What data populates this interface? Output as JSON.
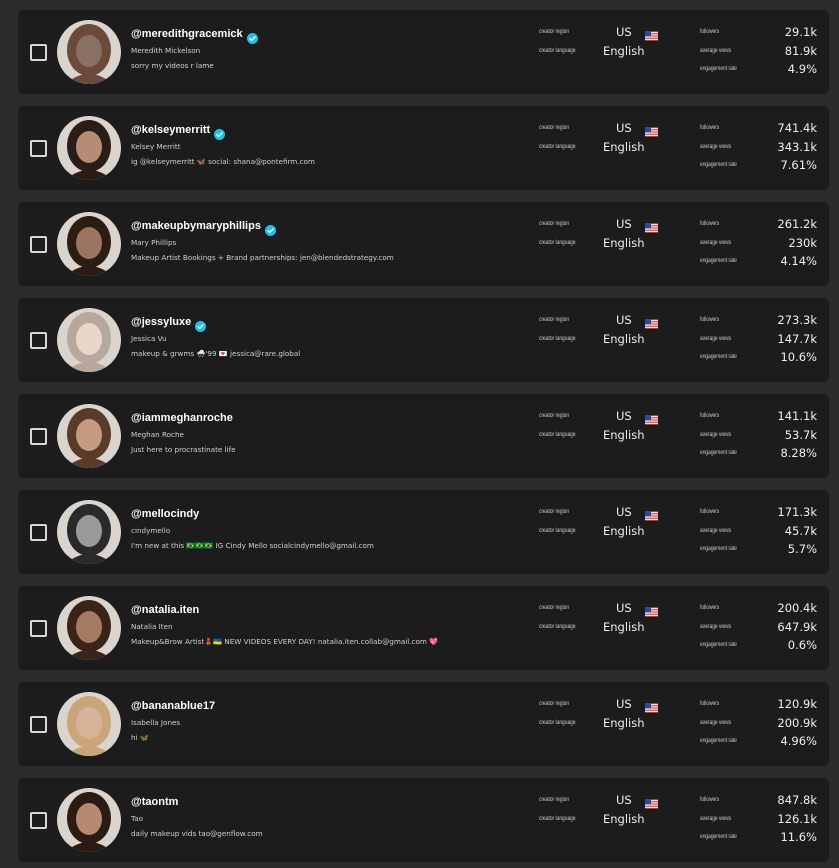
{
  "labels": {
    "creator_region": "creator region",
    "creator_language": "creator language",
    "followers": "followers",
    "average_views": "average views",
    "engagement_rate": "engagement rate"
  },
  "colors": {
    "card": "#1c1c1c",
    "background": "#2b2b2b",
    "verified": "#20c1ea"
  },
  "creators": [
    {
      "handle": "@meredithgracemick",
      "verified": true,
      "name": "Meredith Mickelson",
      "bio": "sorry my videos r lame",
      "region": "US",
      "language": "English",
      "followers": "29.1k",
      "average_views": "81.9k",
      "engagement_rate": "4.9%",
      "avatar_tone": "#8a6f63",
      "avatar_hair": "#6b4a3a"
    },
    {
      "handle": "@kelseymerritt",
      "verified": true,
      "name": "Kelsey Merritt",
      "bio": "ig @kelseymerritt 🦋 social: shana@pontefirm.com",
      "region": "US",
      "language": "English",
      "followers": "741.4k",
      "average_views": "343.1k",
      "engagement_rate": "7.61%",
      "avatar_tone": "#b58c76",
      "avatar_hair": "#2a1c16"
    },
    {
      "handle": "@makeupbymaryphillips",
      "verified": true,
      "name": "Mary Phillips",
      "bio": "Makeup Artist Bookings + Brand partnerships: jen@blendedstrategy.com",
      "region": "US",
      "language": "English",
      "followers": "261.2k",
      "average_views": "230k",
      "engagement_rate": "4.14%",
      "avatar_tone": "#9c7560",
      "avatar_hair": "#2c1d14"
    },
    {
      "handle": "@jessyluxe",
      "verified": true,
      "name": "Jessica Vu",
      "bio": "makeup & grwms 🌨️'99 💌 jessica@rare.global",
      "region": "US",
      "language": "English",
      "followers": "273.3k",
      "average_views": "147.7k",
      "engagement_rate": "10.6%",
      "avatar_tone": "#e9d7cc",
      "avatar_hair": "#b8a79c"
    },
    {
      "handle": "@iammeghanroche",
      "verified": false,
      "name": "Meghan Roche",
      "bio": "Just here to procrastinate life",
      "region": "US",
      "language": "English",
      "followers": "141.1k",
      "average_views": "53.7k",
      "engagement_rate": "8.28%",
      "avatar_tone": "#c49a82",
      "avatar_hair": "#5a3a28"
    },
    {
      "handle": "@mellocindy",
      "verified": false,
      "name": "cindymello",
      "bio": "I'm new at this 🇧🇷🇧🇷🇧🇷 IG Cindy Mello socialcindymello@gmail.com",
      "region": "US",
      "language": "English",
      "followers": "171.3k",
      "average_views": "45.7k",
      "engagement_rate": "5.7%",
      "avatar_tone": "#9a9a9a",
      "avatar_hair": "#2a2a2a"
    },
    {
      "handle": "@natalia.iten",
      "verified": false,
      "name": "Natalia Iten",
      "bio": "Makeup&Brow Artist💄🇺🇦 NEW VIDEOS EVERY DAY! natalia.iten.collab@gmail.com 💖",
      "region": "US",
      "language": "English",
      "followers": "200.4k",
      "average_views": "647.9k",
      "engagement_rate": "0.6%",
      "avatar_tone": "#a57a62",
      "avatar_hair": "#3a2418"
    },
    {
      "handle": "@bananablue17",
      "verified": false,
      "name": "Isabella Jones",
      "bio": "hi 🦋",
      "region": "US",
      "language": "English",
      "followers": "120.9k",
      "average_views": "200.9k",
      "engagement_rate": "4.96%",
      "avatar_tone": "#d8b39a",
      "avatar_hair": "#caa57a"
    },
    {
      "handle": "@taontm",
      "verified": false,
      "name": "Tao",
      "bio": "daily makeup vids  tao@genflow.com",
      "region": "US",
      "language": "English",
      "followers": "847.8k",
      "average_views": "126.1k",
      "engagement_rate": "11.6%",
      "avatar_tone": "#b58a70",
      "avatar_hair": "#2b1b12"
    }
  ]
}
